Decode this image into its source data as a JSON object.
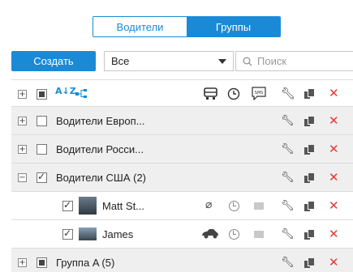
{
  "tabs": [
    {
      "label": "Водители",
      "active": false
    },
    {
      "label": "Группы",
      "active": true
    }
  ],
  "toolbar": {
    "create_label": "Создать",
    "filter_value": "Все",
    "search_placeholder": "Поиск"
  },
  "header": {
    "sort_icon": "A↓Z",
    "columns": [
      "vehicle-icon",
      "clock-icon",
      "sms-icon",
      "wrench-icon",
      "copy-icon",
      "delete-icon"
    ]
  },
  "rows": [
    {
      "name": "Водители Европ...",
      "kind": "group",
      "expanded": false,
      "checked": false
    },
    {
      "name": "Водители Росси...",
      "kind": "group",
      "expanded": false,
      "checked": false
    },
    {
      "name": "Водители США (2)",
      "kind": "group",
      "expanded": true,
      "checked": true
    },
    {
      "name": "Matt St...",
      "kind": "driver",
      "checked": true
    },
    {
      "name": "James",
      "kind": "driver",
      "checked": true
    },
    {
      "name": "Группа A (5)",
      "kind": "group",
      "expanded": false,
      "checked": "partial"
    }
  ],
  "colors": {
    "accent": "#1a8ad6",
    "delete": "#e53935",
    "group_bg": "#efefef"
  }
}
